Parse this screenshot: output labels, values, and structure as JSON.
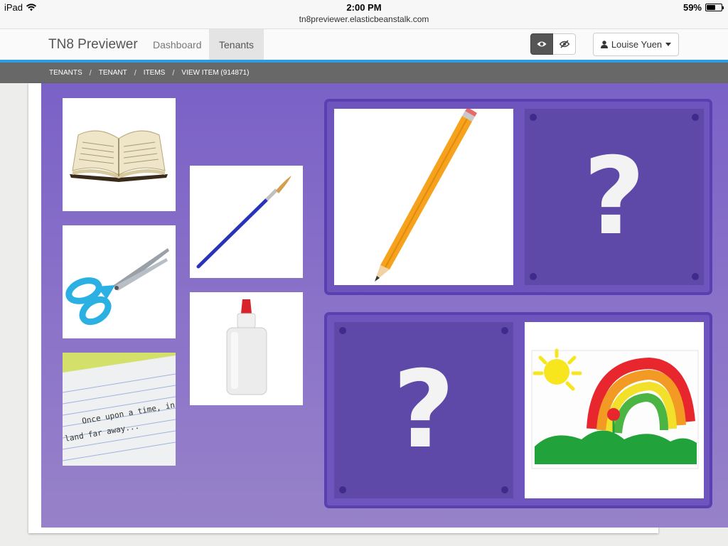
{
  "status": {
    "device": "iPad",
    "time": "2:00 PM",
    "url": "tn8previewer.elasticbeanstalk.com",
    "battery": "59%",
    "battery_level": 0.59
  },
  "nav": {
    "brand": "TN8 Previewer",
    "items": [
      {
        "label": "Dashboard"
      },
      {
        "label": "Tenants"
      }
    ],
    "user": "Louise Yuen"
  },
  "breadcrumb": [
    "TENANTS",
    "TENANT",
    "ITEMS",
    "VIEW ITEM (914871)"
  ],
  "item": {
    "sources": [
      {
        "icon": "open-book-icon"
      },
      {
        "icon": "paintbrush-icon"
      },
      {
        "icon": "scissors-icon"
      },
      {
        "icon": "glue-bottle-icon"
      },
      {
        "icon": "lined-paper-icon",
        "handwriting": [
          "Once upon a time, in",
          "land far away..."
        ]
      }
    ],
    "pairs": [
      {
        "left": "pencil-icon",
        "right": "?"
      },
      {
        "left": "?",
        "right": "rainbow-painting-icon"
      }
    ]
  },
  "colors": {
    "stage": "#7a61c6",
    "accent": "#2d9fe0",
    "breadcrumb_bg": "#686868",
    "drop_border": "#5a3fb0"
  }
}
